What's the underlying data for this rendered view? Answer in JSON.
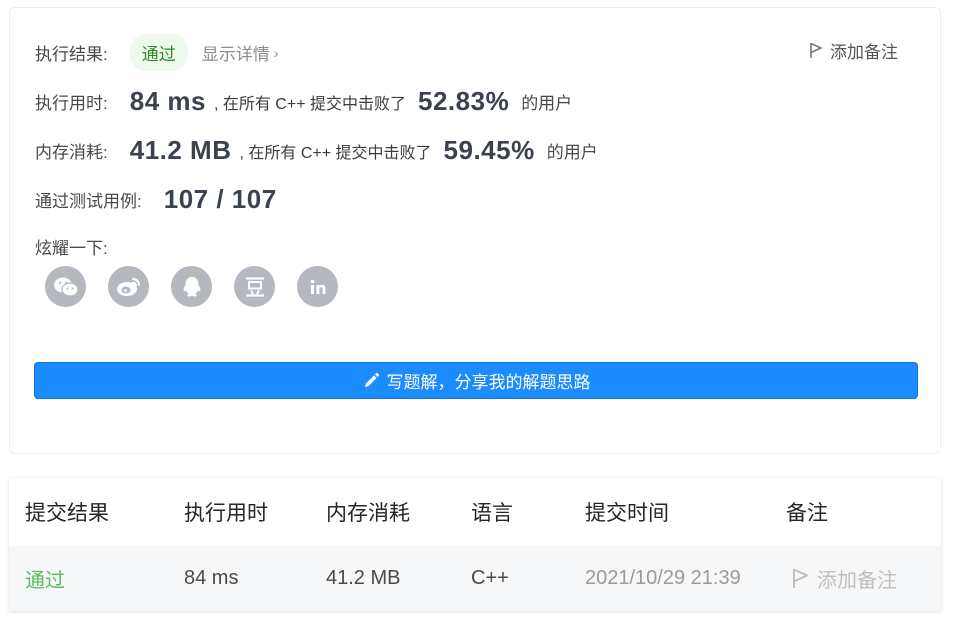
{
  "result": {
    "label": "执行结果:",
    "status": "通过",
    "details_link": "显示详情",
    "add_note": "添加备注"
  },
  "runtime": {
    "label": "执行用时:",
    "value": "84 ms",
    "middle_text": ", 在所有 C++ 提交中击败了",
    "percent": "52.83%",
    "suffix": "的用户"
  },
  "memory": {
    "label": "内存消耗:",
    "value": "41.2 MB",
    "middle_text": ", 在所有 C++ 提交中击败了",
    "percent": "59.45%",
    "suffix": "的用户"
  },
  "testcases": {
    "label": "通过测试用例:",
    "value": "107 / 107"
  },
  "share": {
    "label": "炫耀一下:",
    "icons": [
      "wechat-icon",
      "weibo-icon",
      "qq-icon",
      "douban-icon",
      "linkedin-icon"
    ]
  },
  "solution_button": "写题解，分享我的解题思路",
  "table": {
    "headers": [
      "提交结果",
      "执行用时",
      "内存消耗",
      "语言",
      "提交时间",
      "备注"
    ],
    "rows": [
      {
        "status": "通过",
        "runtime": "84 ms",
        "memory": "41.2 MB",
        "language": "C++",
        "time": "2021/10/29 21:39",
        "note": "添加备注"
      }
    ]
  },
  "colors": {
    "accent": "#1a8cff",
    "success": "#5cb85c",
    "icon_gray": "#b5b8be"
  }
}
